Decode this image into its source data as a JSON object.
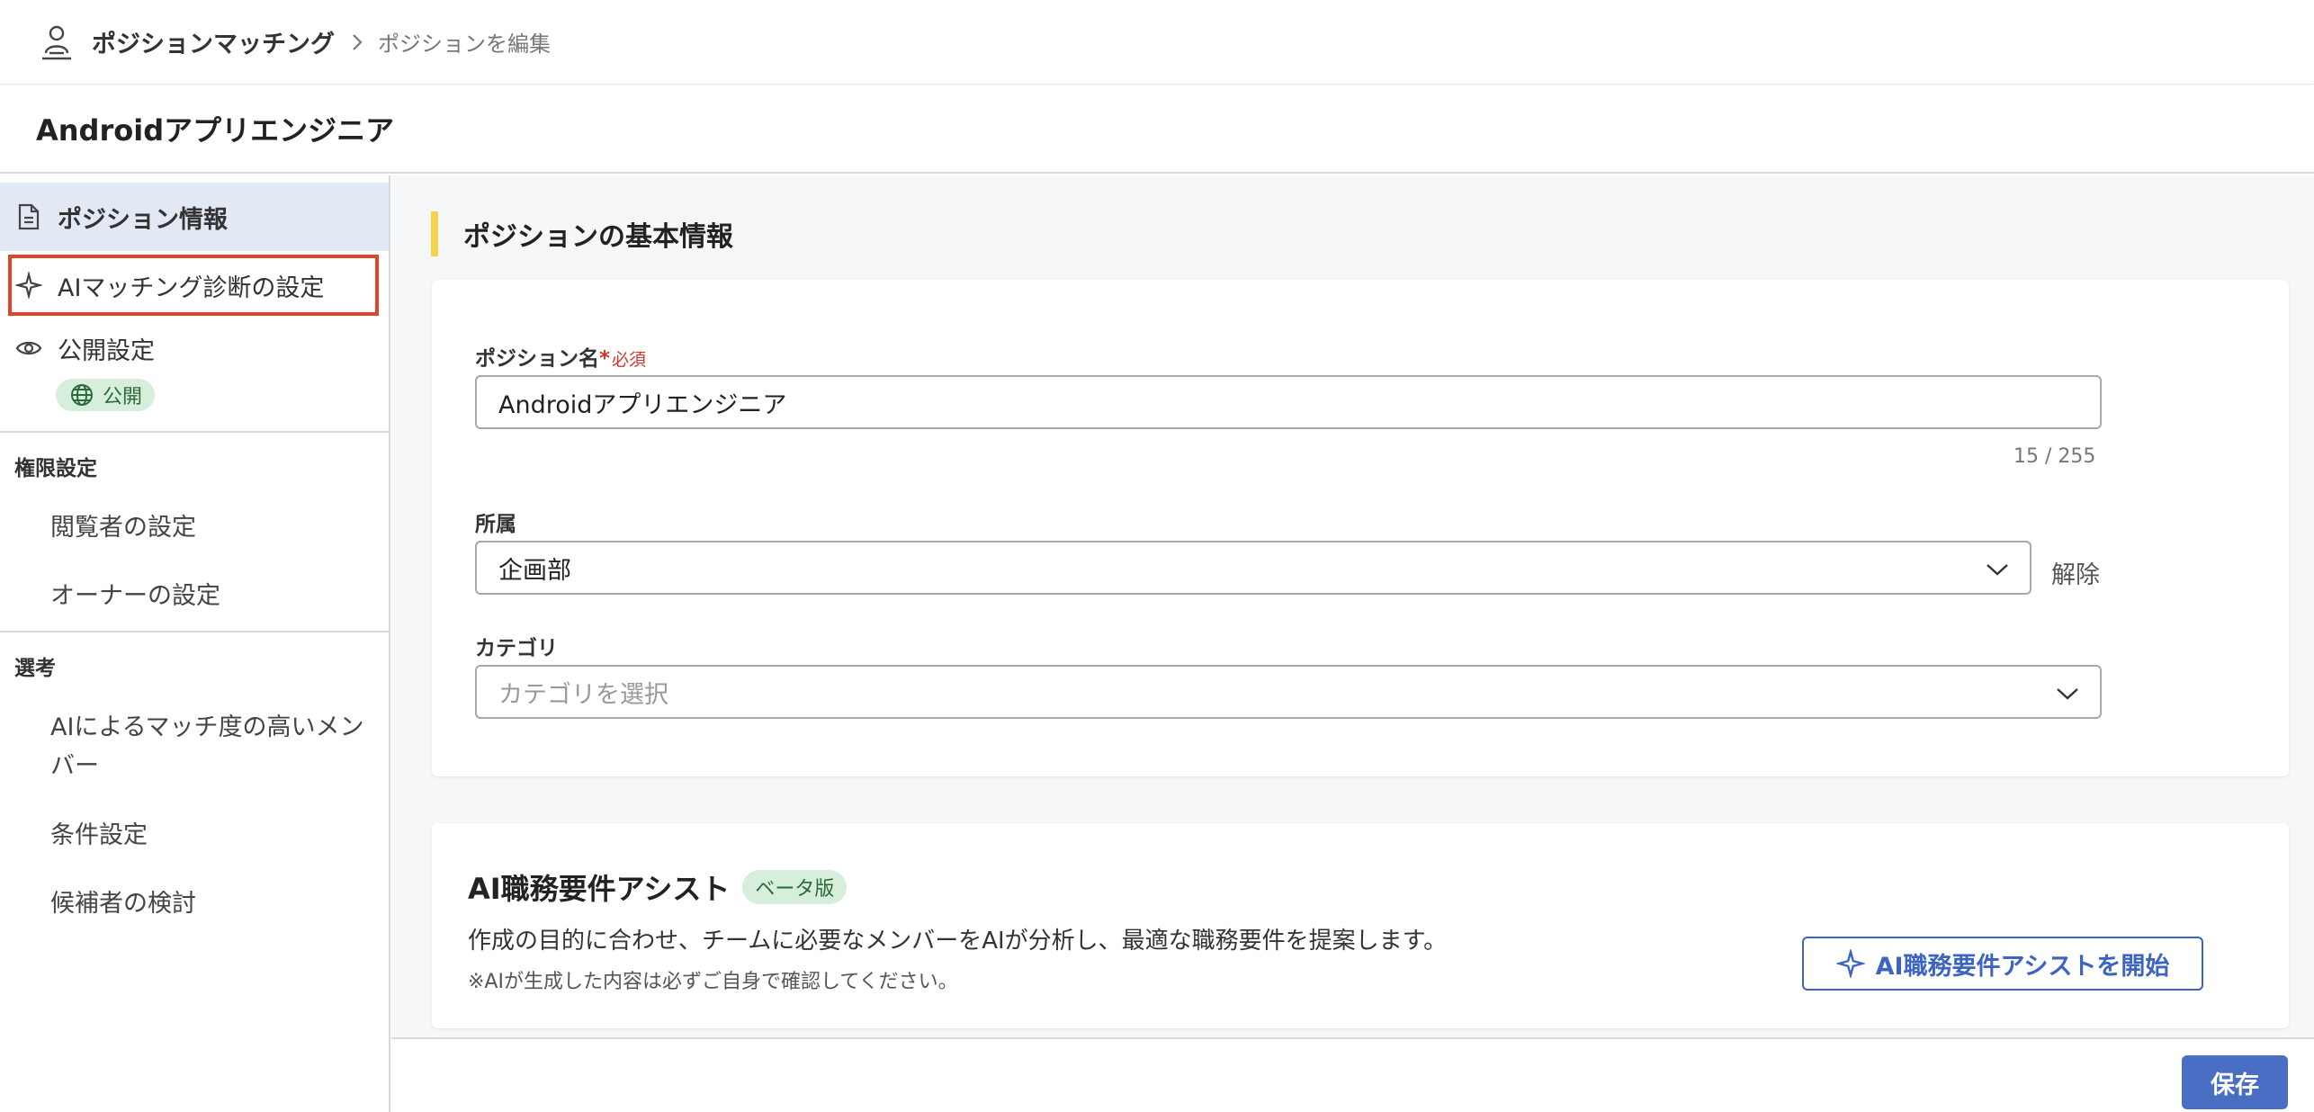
{
  "header": {
    "app_name": "ポジションマッチング",
    "breadcrumb_current": "ポジションを編集"
  },
  "page": {
    "title": "Androidアプリエンジニア"
  },
  "sidebar": {
    "items": [
      {
        "label": "ポジション情報",
        "icon": "document-icon",
        "active": true
      },
      {
        "label": "AIマッチング診断の設定",
        "icon": "sparkle-icon",
        "highlighted": true
      },
      {
        "label": "公開設定",
        "icon": "eye-icon"
      }
    ],
    "public_badge": "公開",
    "sections": [
      {
        "title": "権限設定",
        "items": [
          "閲覧者の設定",
          "オーナーの設定"
        ]
      },
      {
        "title": "選考",
        "items": [
          "AIによるマッチ度の高いメンバー",
          "条件設定",
          "候補者の検討"
        ]
      }
    ]
  },
  "main": {
    "section_title": "ポジションの基本情報",
    "position_name": {
      "label": "ポジション名",
      "required_mark": "*",
      "required_text": "必須",
      "value": "Androidアプリエンジニア",
      "counter": "15 / 255"
    },
    "department": {
      "label": "所属",
      "value": "企画部",
      "clear_label": "解除"
    },
    "category": {
      "label": "カテゴリ",
      "placeholder": "カテゴリを選択"
    },
    "assist": {
      "title": "AI職務要件アシスト",
      "badge": "ベータ版",
      "description": "作成の目的に合わせ、チームに必要なメンバーをAIが分析し、最適な職務要件を提案します。",
      "note": "※AIが生成した内容は必ずご自身で確認してください。",
      "button_label": "AI職務要件アシストを開始"
    }
  },
  "footer": {
    "save_label": "保存"
  },
  "colors": {
    "accent": "#4a6ec4",
    "highlight_outline": "#e0452b",
    "section_bar": "#f4d24a",
    "badge_bg": "#d7eedd"
  }
}
